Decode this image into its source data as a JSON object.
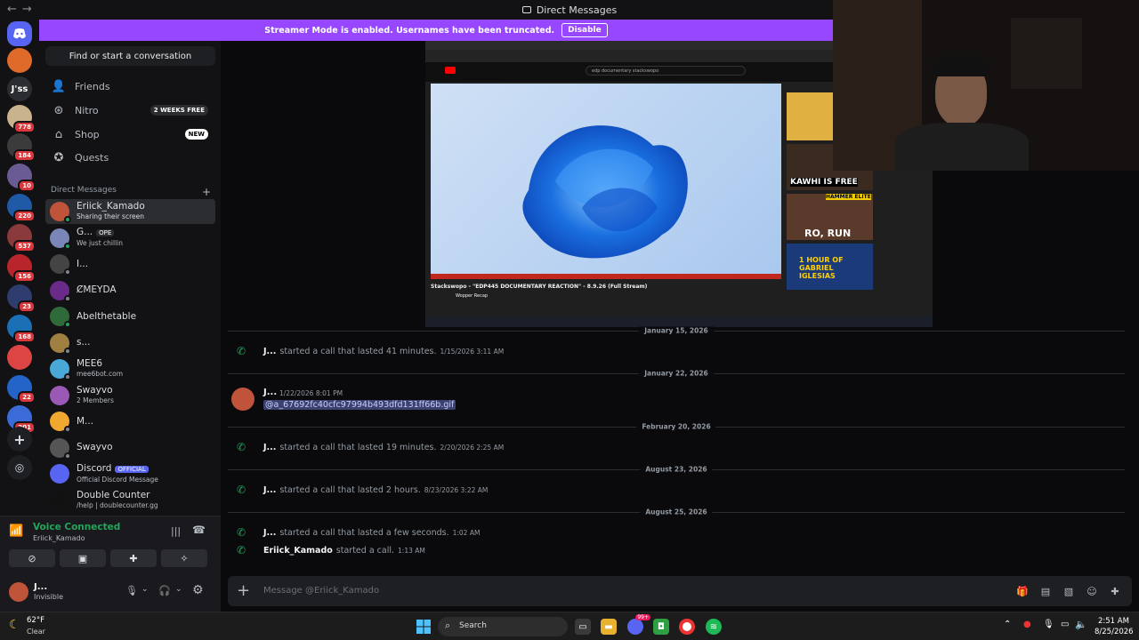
{
  "window": {
    "title": "Direct Messages",
    "nav_back": "←",
    "nav_fwd": "→"
  },
  "rail": {
    "servers": [
      {
        "label": "",
        "badge": "",
        "color": "#e06a2a"
      },
      {
        "label": "J'ss",
        "badge": "",
        "color": "#2b2d31"
      },
      {
        "label": "",
        "badge": "778",
        "color": "#c9b38c"
      },
      {
        "label": "",
        "badge": "184",
        "color": "#3b3b3b"
      },
      {
        "label": "",
        "badge": "10",
        "color": "#6b5b95"
      },
      {
        "label": "",
        "badge": "220",
        "color": "#1f5aa6"
      },
      {
        "label": "",
        "badge": "537",
        "color": "#8a3a3a"
      },
      {
        "label": "",
        "badge": "156",
        "color": "#b8262b"
      },
      {
        "label": "",
        "badge": "23",
        "color": "#2e3c6e"
      },
      {
        "label": "",
        "badge": "168",
        "color": "#1b6fb5"
      },
      {
        "label": "",
        "badge": "",
        "color": "#d44"
      },
      {
        "label": "",
        "badge": "22",
        "color": "#2464c8"
      },
      {
        "label": "",
        "badge": "201",
        "color": "#3a6bd8"
      }
    ]
  },
  "sidebar": {
    "search_label": "Find or start a conversation",
    "nav": [
      {
        "label": "Friends",
        "tag": ""
      },
      {
        "label": "Nitro",
        "tag": "2 WEEKS FREE"
      },
      {
        "label": "Shop",
        "tag": "NEW"
      },
      {
        "label": "Quests",
        "tag": ""
      }
    ],
    "dm_header": "Direct Messages",
    "dm_add": "+",
    "dms": [
      {
        "name": "Eriick_Kamado",
        "sub": "Sharing their screen",
        "color": "#c0543a",
        "status": "#23a55a"
      },
      {
        "name": "G...",
        "badge": "OPE",
        "sub": "We just chillin",
        "color": "#7a86b8",
        "status": "#23a55a"
      },
      {
        "name": "I...",
        "sub": "",
        "color": "#444",
        "status": "#80848e"
      },
      {
        "name": "ȻMEYDA",
        "sub": "",
        "color": "#6a2a8a",
        "status": "#80848e"
      },
      {
        "name": "Abelthetable",
        "sub": "",
        "color": "#2f6a3a",
        "status": "#23a55a"
      },
      {
        "name": "s...",
        "sub": "",
        "color": "#a08040",
        "status": "#80848e"
      },
      {
        "name": "MEE6",
        "sub": "mee6bot.com",
        "color": "#4aa8d8",
        "status": "#80848e"
      },
      {
        "name": "Swayvo",
        "sub": "2 Members",
        "color": "#9b59b6",
        "status": ""
      },
      {
        "name": "M...",
        "sub": "",
        "color": "#f0a830",
        "status": "#80848e"
      },
      {
        "name": "Swayvo",
        "sub": "",
        "color": "#555",
        "status": "#80848e"
      },
      {
        "name": "Discord",
        "badge": "OFFICIAL",
        "sub": "Official Discord Message",
        "color": "#5865f2",
        "status": ""
      },
      {
        "name": "Double Counter",
        "sub": "/help | doublecounter.gg",
        "color": "#111",
        "status": ""
      }
    ]
  },
  "voice": {
    "status": "Voice Connected",
    "channel": "Eriick_Kamado"
  },
  "user": {
    "name": "J...",
    "status": "Invisible"
  },
  "streamer": {
    "message": "Streamer Mode is enabled. Usernames have been truncated.",
    "button": "Disable"
  },
  "stream": {
    "video_title": "Stackswopo - \"EDP445 DOCUMENTARY REACTION\" - 8.9.26 (Full Stream)",
    "channel": "Wopper Recap",
    "search": "edp documentary stackswopo",
    "thumbs": [
      "KAWHI IS FREE",
      "HAMMER ELITE",
      "RO, RUN",
      "1 HOUR OF GABRIEL IGLESIAS"
    ]
  },
  "chat": {
    "dividers": [
      "January 15, 2026",
      "January 22, 2026",
      "February 20, 2026",
      "August 23, 2026",
      "August 25, 2026"
    ],
    "calls": [
      {
        "user": "J...",
        "text": "started a call that lasted 41 minutes.",
        "time": "1/15/2026 3:11 AM"
      },
      {
        "user": "J...",
        "text": "started a call that lasted 19 minutes.",
        "time": "2/20/2026 2:25 AM"
      },
      {
        "user": "J...",
        "text": "started a call that lasted 2 hours.",
        "time": "8/23/2026 3:22 AM"
      },
      {
        "user": "J...",
        "text": "started a call that lasted a few seconds.",
        "time": "1:02 AM"
      },
      {
        "user": "Eriick_Kamado",
        "text": "started a call.",
        "time": "1:13 AM"
      }
    ],
    "message": {
      "user": "J...",
      "time": "1/22/2026 8:01 PM",
      "link": "a_67692fc40cfc97994b493dfd131ff66b.gif"
    }
  },
  "composer": {
    "placeholder": "Message @Eriick_Kamado"
  },
  "taskbar": {
    "weather_temp": "62°F",
    "weather_desc": "Clear",
    "search": "Search",
    "time": "2:51 AM",
    "date": "8/25/2026",
    "discord_badge": "99+"
  }
}
